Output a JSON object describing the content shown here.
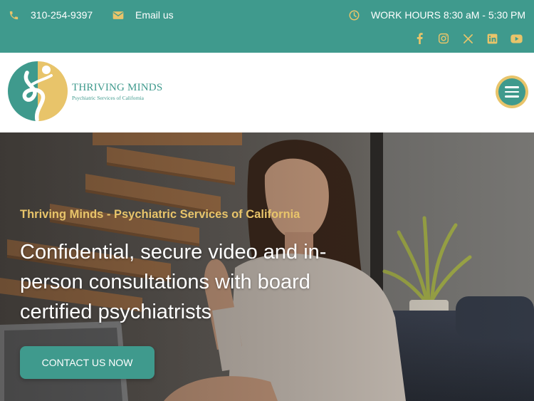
{
  "colors": {
    "teal": "#3f9a8d",
    "gold": "#e8c46a",
    "white": "#ffffff"
  },
  "topbar": {
    "phone": {
      "icon": "phone-icon",
      "label": "310-254-9397"
    },
    "email": {
      "icon": "envelope-icon",
      "label": "Email us"
    },
    "hours": {
      "icon": "clock-icon",
      "label": "WORK HOURS 8:30 aM - 5:30 PM"
    },
    "socials": [
      "facebook-icon",
      "instagram-icon",
      "x-icon",
      "linkedin-icon",
      "youtube-icon"
    ]
  },
  "header": {
    "logo": {
      "name": "THRIVING MINDS",
      "tagline": "Psychiatric Services of California"
    },
    "menu_icon": "hamburger-menu-icon"
  },
  "hero": {
    "eyebrow": "Thriving Minds - Psychiatric Services of California",
    "title": "Confidential, secure video and in-person consultations with board certified psychiatrists",
    "cta_label": "CONTACT US NOW"
  }
}
